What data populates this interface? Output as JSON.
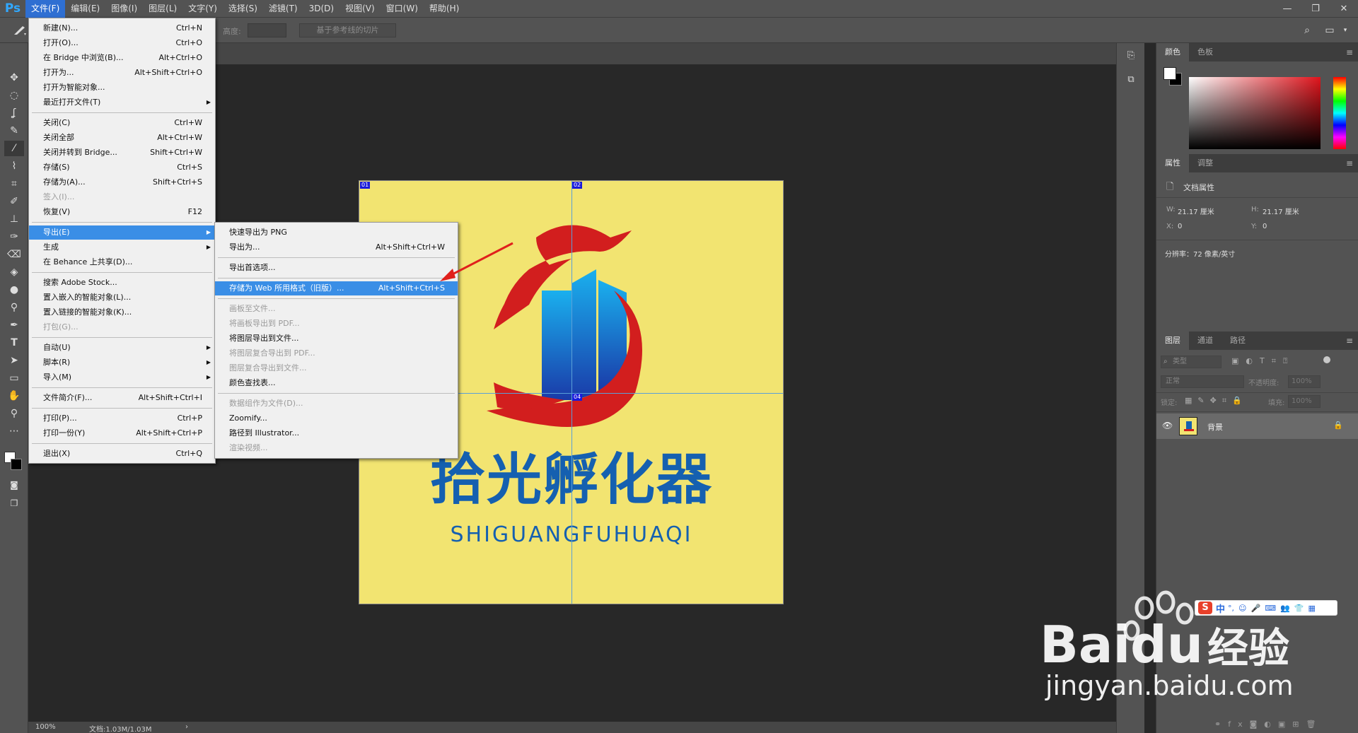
{
  "app": {
    "logo": "Ps"
  },
  "menubar": {
    "items": [
      "文件(F)",
      "编辑(E)",
      "图像(I)",
      "图层(L)",
      "文字(Y)",
      "选择(S)",
      "滤镜(T)",
      "3D(D)",
      "视图(V)",
      "窗口(W)",
      "帮助(H)"
    ]
  },
  "window_controls": {
    "minimize": "—",
    "restore": "❐",
    "close": "✕"
  },
  "options_bar": {
    "height_label": "高度:",
    "slice_button": "基于参考线的切片"
  },
  "status": {
    "zoom": "100%",
    "doc": "文档:1.03M/1.03M",
    "arrow": "›"
  },
  "file_menu": [
    {
      "label": "新建(N)...",
      "shortcut": "Ctrl+N",
      "disabled": false,
      "submenu": false
    },
    {
      "label": "打开(O)...",
      "shortcut": "Ctrl+O",
      "disabled": false,
      "submenu": false
    },
    {
      "label": "在 Bridge 中浏览(B)...",
      "shortcut": "Alt+Ctrl+O",
      "disabled": false,
      "submenu": false
    },
    {
      "label": "打开为...",
      "shortcut": "Alt+Shift+Ctrl+O",
      "disabled": false,
      "submenu": false
    },
    {
      "label": "打开为智能对象...",
      "shortcut": "",
      "disabled": false,
      "submenu": false
    },
    {
      "label": "最近打开文件(T)",
      "shortcut": "",
      "disabled": false,
      "submenu": true
    },
    {
      "sep": true
    },
    {
      "label": "关闭(C)",
      "shortcut": "Ctrl+W",
      "disabled": false,
      "submenu": false
    },
    {
      "label": "关闭全部",
      "shortcut": "Alt+Ctrl+W",
      "disabled": false,
      "submenu": false
    },
    {
      "label": "关闭并转到 Bridge...",
      "shortcut": "Shift+Ctrl+W",
      "disabled": false,
      "submenu": false
    },
    {
      "label": "存储(S)",
      "shortcut": "Ctrl+S",
      "disabled": false,
      "submenu": false
    },
    {
      "label": "存储为(A)...",
      "shortcut": "Shift+Ctrl+S",
      "disabled": false,
      "submenu": false
    },
    {
      "label": "签入(I)...",
      "shortcut": "",
      "disabled": true,
      "submenu": false
    },
    {
      "label": "恢复(V)",
      "shortcut": "F12",
      "disabled": false,
      "submenu": false
    },
    {
      "sep": true
    },
    {
      "label": "导出(E)",
      "shortcut": "",
      "disabled": false,
      "submenu": true,
      "highlight": true
    },
    {
      "label": "生成",
      "shortcut": "",
      "disabled": false,
      "submenu": true
    },
    {
      "label": "在 Behance 上共享(D)...",
      "shortcut": "",
      "disabled": false,
      "submenu": false
    },
    {
      "sep": true
    },
    {
      "label": "搜索 Adobe Stock...",
      "shortcut": "",
      "disabled": false,
      "submenu": false
    },
    {
      "label": "置入嵌入的智能对象(L)...",
      "shortcut": "",
      "disabled": false,
      "submenu": false
    },
    {
      "label": "置入链接的智能对象(K)...",
      "shortcut": "",
      "disabled": false,
      "submenu": false
    },
    {
      "label": "打包(G)...",
      "shortcut": "",
      "disabled": true,
      "submenu": false
    },
    {
      "sep": true
    },
    {
      "label": "自动(U)",
      "shortcut": "",
      "disabled": false,
      "submenu": true
    },
    {
      "label": "脚本(R)",
      "shortcut": "",
      "disabled": false,
      "submenu": true
    },
    {
      "label": "导入(M)",
      "shortcut": "",
      "disabled": false,
      "submenu": true
    },
    {
      "sep": true
    },
    {
      "label": "文件简介(F)...",
      "shortcut": "Alt+Shift+Ctrl+I",
      "disabled": false,
      "submenu": false
    },
    {
      "sep": true
    },
    {
      "label": "打印(P)...",
      "shortcut": "Ctrl+P",
      "disabled": false,
      "submenu": false
    },
    {
      "label": "打印一份(Y)",
      "shortcut": "Alt+Shift+Ctrl+P",
      "disabled": false,
      "submenu": false
    },
    {
      "sep": true
    },
    {
      "label": "退出(X)",
      "shortcut": "Ctrl+Q",
      "disabled": false,
      "submenu": false
    }
  ],
  "export_menu": [
    {
      "label": "快速导出为 PNG",
      "shortcut": "",
      "disabled": false
    },
    {
      "label": "导出为...",
      "shortcut": "Alt+Shift+Ctrl+W",
      "disabled": false
    },
    {
      "sep": true
    },
    {
      "label": "导出首选项...",
      "shortcut": "",
      "disabled": false
    },
    {
      "sep": true
    },
    {
      "label": "存储为 Web 所用格式（旧版）...",
      "shortcut": "Alt+Shift+Ctrl+S",
      "disabled": false,
      "highlight": true
    },
    {
      "sep": true
    },
    {
      "label": "画板至文件...",
      "shortcut": "",
      "disabled": true
    },
    {
      "label": "将画板导出到 PDF...",
      "shortcut": "",
      "disabled": true
    },
    {
      "label": "将图层导出到文件...",
      "shortcut": "",
      "disabled": false
    },
    {
      "label": "将图层复合导出到 PDF...",
      "shortcut": "",
      "disabled": true
    },
    {
      "label": "图层复合导出到文件...",
      "shortcut": "",
      "disabled": true
    },
    {
      "label": "颜色查找表...",
      "shortcut": "",
      "disabled": false
    },
    {
      "sep": true
    },
    {
      "label": "数据组作为文件(D)...",
      "shortcut": "",
      "disabled": true
    },
    {
      "label": "Zoomify...",
      "shortcut": "",
      "disabled": false
    },
    {
      "label": "路径到 Illustrator...",
      "shortcut": "",
      "disabled": false
    },
    {
      "label": "渲染视频...",
      "shortcut": "",
      "disabled": true
    }
  ],
  "color_panel": {
    "tabs": [
      "颜色",
      "色板"
    ],
    "menu_icon": "≡"
  },
  "props_panel": {
    "tabs": [
      "属性",
      "调整"
    ],
    "title": "文档属性",
    "w_label": "W:",
    "w_value": "21.17 厘米",
    "h_label": "H:",
    "h_value": "21.17 厘米",
    "x_label": "X:",
    "x_value": "0",
    "y_label": "Y:",
    "y_value": "0",
    "resolution": "分辨率：72 像素/英寸"
  },
  "layers_panel": {
    "tabs": [
      "图层",
      "通道",
      "路径"
    ],
    "filter_placeholder": "类型",
    "blend_mode": "正常",
    "opacity_label": "不透明度:",
    "opacity_value": "100%",
    "lock_label": "锁定:",
    "fill_label": "填充:",
    "fill_value": "100%",
    "layer_name": "背景"
  },
  "document": {
    "logo_cn": "拾光孵化器",
    "logo_en": "SHIGUANGFUHUAQI",
    "slice_tags": [
      "01",
      "02",
      "04"
    ],
    "bg_color": "#f2e471",
    "blue": "#1560b0",
    "red": "#d21e1e"
  },
  "ime_bar": {
    "items": [
      "中",
      "°,",
      "☺",
      "🎤",
      "⌨",
      "👥",
      "👕",
      "▦"
    ]
  },
  "watermark": {
    "brand_a": "Bai",
    "brand_b": "du",
    "suffix": "经验",
    "url": "jingyan.baidu.com"
  }
}
